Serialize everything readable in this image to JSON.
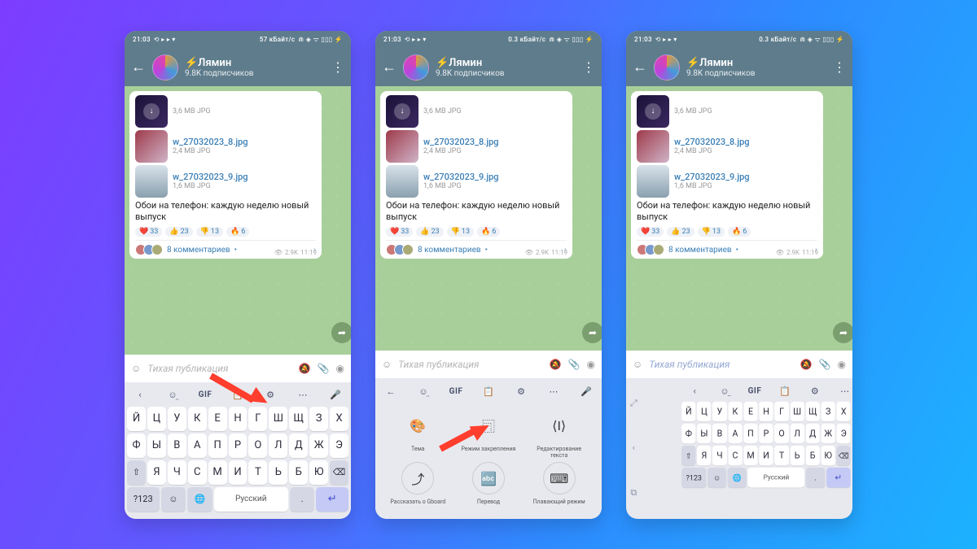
{
  "status": {
    "time": "21:03",
    "speed": "0.3 кБайт/с",
    "speed_alt": "57 кБайт/с"
  },
  "channel": {
    "name": "⚡Лямин",
    "subs": "9.8K подписчиков"
  },
  "files": [
    {
      "name": "",
      "size": "3,6 MB JPG"
    },
    {
      "name": "w_27032023_8.jpg",
      "size": "2,4 MB JPG"
    },
    {
      "name": "w_27032023_9.jpg",
      "size": "1,6 MB JPG"
    }
  ],
  "caption": "Обои на телефон: каждую неделю новый выпуск",
  "reactions": [
    {
      "e": "❤️",
      "n": "33"
    },
    {
      "e": "👍",
      "n": "23"
    },
    {
      "e": "👎",
      "n": "13"
    },
    {
      "e": "🔥",
      "n": "6"
    }
  ],
  "views": "2.9K",
  "time": "11:19",
  "comments": "8 комментариев",
  "input_placeholder": "Тихая публикация",
  "kbd": {
    "gif": "GIF",
    "row1": [
      "Й",
      "Ц",
      "У",
      "К",
      "Е",
      "Н",
      "Г",
      "Ш",
      "Щ",
      "З",
      "Х"
    ],
    "row2": [
      "Ф",
      "Ы",
      "В",
      "А",
      "П",
      "Р",
      "О",
      "Л",
      "Д",
      "Ж",
      "Э"
    ],
    "row3": [
      "Я",
      "Ч",
      "С",
      "М",
      "И",
      "Т",
      "Ь",
      "Б",
      "Ю"
    ],
    "shift": "⇧",
    "del": "⌫",
    "num": "?123",
    "lang": "Русский",
    "comma": ",",
    "dot": ".",
    "emoji": "☺",
    "globe": "🌐",
    "enter": "↵"
  },
  "menu": {
    "r1": [
      {
        "lbl": "Тема"
      },
      {
        "lbl": "Режим закрепления"
      },
      {
        "lbl": "Редактирование текста"
      }
    ],
    "r2": [
      {
        "lbl": "Рассказать о Gboard"
      },
      {
        "lbl": "Перевод"
      },
      {
        "lbl": "Плавающий режим"
      }
    ]
  }
}
